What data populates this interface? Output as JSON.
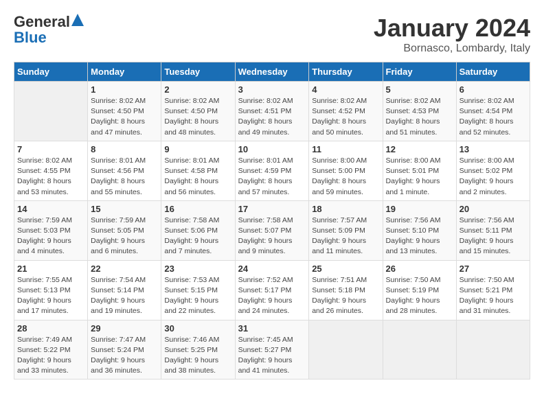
{
  "header": {
    "logo_general": "General",
    "logo_blue": "Blue",
    "title": "January 2024",
    "location": "Bornasco, Lombardy, Italy"
  },
  "days_of_week": [
    "Sunday",
    "Monday",
    "Tuesday",
    "Wednesday",
    "Thursday",
    "Friday",
    "Saturday"
  ],
  "weeks": [
    [
      {
        "day": "",
        "sunrise": "",
        "sunset": "",
        "daylight": ""
      },
      {
        "day": "1",
        "sunrise": "Sunrise: 8:02 AM",
        "sunset": "Sunset: 4:50 PM",
        "daylight": "Daylight: 8 hours and 47 minutes."
      },
      {
        "day": "2",
        "sunrise": "Sunrise: 8:02 AM",
        "sunset": "Sunset: 4:50 PM",
        "daylight": "Daylight: 8 hours and 48 minutes."
      },
      {
        "day": "3",
        "sunrise": "Sunrise: 8:02 AM",
        "sunset": "Sunset: 4:51 PM",
        "daylight": "Daylight: 8 hours and 49 minutes."
      },
      {
        "day": "4",
        "sunrise": "Sunrise: 8:02 AM",
        "sunset": "Sunset: 4:52 PM",
        "daylight": "Daylight: 8 hours and 50 minutes."
      },
      {
        "day": "5",
        "sunrise": "Sunrise: 8:02 AM",
        "sunset": "Sunset: 4:53 PM",
        "daylight": "Daylight: 8 hours and 51 minutes."
      },
      {
        "day": "6",
        "sunrise": "Sunrise: 8:02 AM",
        "sunset": "Sunset: 4:54 PM",
        "daylight": "Daylight: 8 hours and 52 minutes."
      }
    ],
    [
      {
        "day": "7",
        "sunrise": "Sunrise: 8:02 AM",
        "sunset": "Sunset: 4:55 PM",
        "daylight": "Daylight: 8 hours and 53 minutes."
      },
      {
        "day": "8",
        "sunrise": "Sunrise: 8:01 AM",
        "sunset": "Sunset: 4:56 PM",
        "daylight": "Daylight: 8 hours and 55 minutes."
      },
      {
        "day": "9",
        "sunrise": "Sunrise: 8:01 AM",
        "sunset": "Sunset: 4:58 PM",
        "daylight": "Daylight: 8 hours and 56 minutes."
      },
      {
        "day": "10",
        "sunrise": "Sunrise: 8:01 AM",
        "sunset": "Sunset: 4:59 PM",
        "daylight": "Daylight: 8 hours and 57 minutes."
      },
      {
        "day": "11",
        "sunrise": "Sunrise: 8:00 AM",
        "sunset": "Sunset: 5:00 PM",
        "daylight": "Daylight: 8 hours and 59 minutes."
      },
      {
        "day": "12",
        "sunrise": "Sunrise: 8:00 AM",
        "sunset": "Sunset: 5:01 PM",
        "daylight": "Daylight: 9 hours and 1 minute."
      },
      {
        "day": "13",
        "sunrise": "Sunrise: 8:00 AM",
        "sunset": "Sunset: 5:02 PM",
        "daylight": "Daylight: 9 hours and 2 minutes."
      }
    ],
    [
      {
        "day": "14",
        "sunrise": "Sunrise: 7:59 AM",
        "sunset": "Sunset: 5:03 PM",
        "daylight": "Daylight: 9 hours and 4 minutes."
      },
      {
        "day": "15",
        "sunrise": "Sunrise: 7:59 AM",
        "sunset": "Sunset: 5:05 PM",
        "daylight": "Daylight: 9 hours and 6 minutes."
      },
      {
        "day": "16",
        "sunrise": "Sunrise: 7:58 AM",
        "sunset": "Sunset: 5:06 PM",
        "daylight": "Daylight: 9 hours and 7 minutes."
      },
      {
        "day": "17",
        "sunrise": "Sunrise: 7:58 AM",
        "sunset": "Sunset: 5:07 PM",
        "daylight": "Daylight: 9 hours and 9 minutes."
      },
      {
        "day": "18",
        "sunrise": "Sunrise: 7:57 AM",
        "sunset": "Sunset: 5:09 PM",
        "daylight": "Daylight: 9 hours and 11 minutes."
      },
      {
        "day": "19",
        "sunrise": "Sunrise: 7:56 AM",
        "sunset": "Sunset: 5:10 PM",
        "daylight": "Daylight: 9 hours and 13 minutes."
      },
      {
        "day": "20",
        "sunrise": "Sunrise: 7:56 AM",
        "sunset": "Sunset: 5:11 PM",
        "daylight": "Daylight: 9 hours and 15 minutes."
      }
    ],
    [
      {
        "day": "21",
        "sunrise": "Sunrise: 7:55 AM",
        "sunset": "Sunset: 5:13 PM",
        "daylight": "Daylight: 9 hours and 17 minutes."
      },
      {
        "day": "22",
        "sunrise": "Sunrise: 7:54 AM",
        "sunset": "Sunset: 5:14 PM",
        "daylight": "Daylight: 9 hours and 19 minutes."
      },
      {
        "day": "23",
        "sunrise": "Sunrise: 7:53 AM",
        "sunset": "Sunset: 5:15 PM",
        "daylight": "Daylight: 9 hours and 22 minutes."
      },
      {
        "day": "24",
        "sunrise": "Sunrise: 7:52 AM",
        "sunset": "Sunset: 5:17 PM",
        "daylight": "Daylight: 9 hours and 24 minutes."
      },
      {
        "day": "25",
        "sunrise": "Sunrise: 7:51 AM",
        "sunset": "Sunset: 5:18 PM",
        "daylight": "Daylight: 9 hours and 26 minutes."
      },
      {
        "day": "26",
        "sunrise": "Sunrise: 7:50 AM",
        "sunset": "Sunset: 5:19 PM",
        "daylight": "Daylight: 9 hours and 28 minutes."
      },
      {
        "day": "27",
        "sunrise": "Sunrise: 7:50 AM",
        "sunset": "Sunset: 5:21 PM",
        "daylight": "Daylight: 9 hours and 31 minutes."
      }
    ],
    [
      {
        "day": "28",
        "sunrise": "Sunrise: 7:49 AM",
        "sunset": "Sunset: 5:22 PM",
        "daylight": "Daylight: 9 hours and 33 minutes."
      },
      {
        "day": "29",
        "sunrise": "Sunrise: 7:47 AM",
        "sunset": "Sunset: 5:24 PM",
        "daylight": "Daylight: 9 hours and 36 minutes."
      },
      {
        "day": "30",
        "sunrise": "Sunrise: 7:46 AM",
        "sunset": "Sunset: 5:25 PM",
        "daylight": "Daylight: 9 hours and 38 minutes."
      },
      {
        "day": "31",
        "sunrise": "Sunrise: 7:45 AM",
        "sunset": "Sunset: 5:27 PM",
        "daylight": "Daylight: 9 hours and 41 minutes."
      },
      {
        "day": "",
        "sunrise": "",
        "sunset": "",
        "daylight": ""
      },
      {
        "day": "",
        "sunrise": "",
        "sunset": "",
        "daylight": ""
      },
      {
        "day": "",
        "sunrise": "",
        "sunset": "",
        "daylight": ""
      }
    ]
  ]
}
